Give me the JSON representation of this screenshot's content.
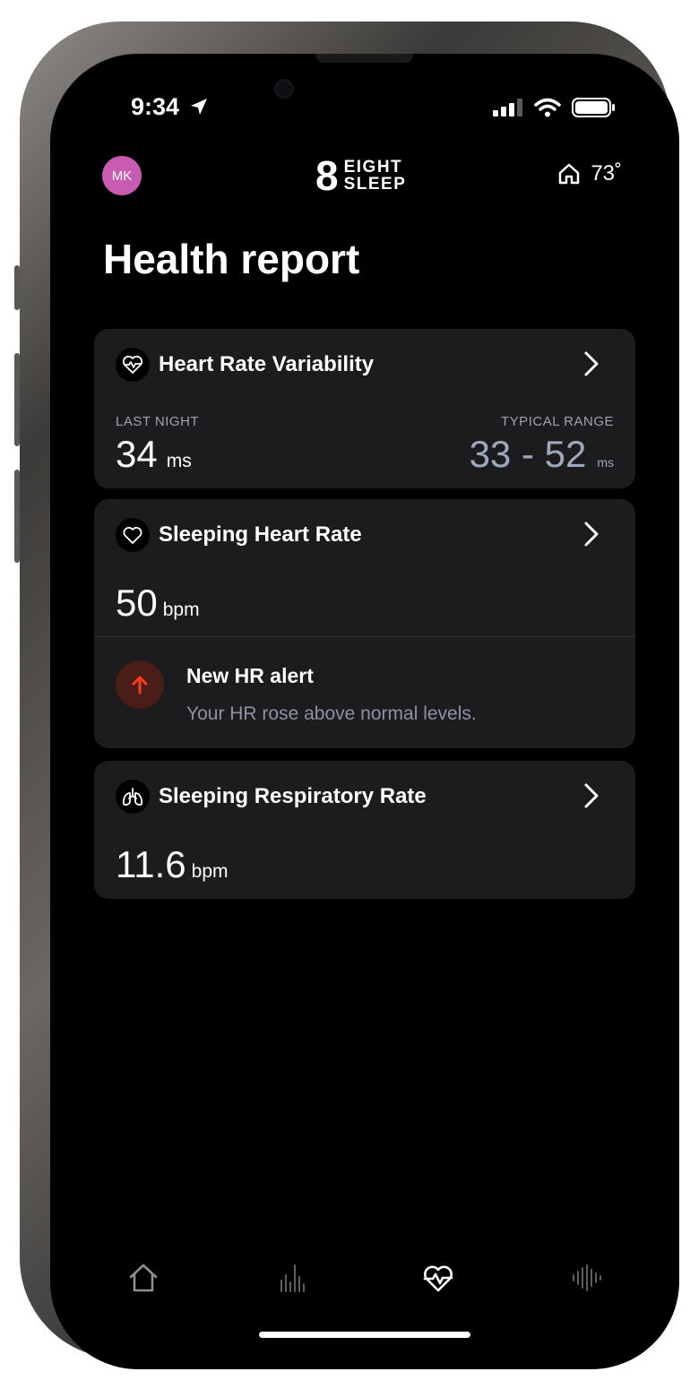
{
  "status_bar": {
    "time": "9:34"
  },
  "header": {
    "avatar_initials": "MK",
    "logo_mark": "8",
    "logo_line1": "EIGHT",
    "logo_line2": "SLEEP",
    "home_temperature": "73˚"
  },
  "page_title": "Health report",
  "cards": {
    "hrv": {
      "title": "Heart Rate Variability",
      "icon": "heart-pulse-icon",
      "last_night_label": "LAST NIGHT",
      "last_night_value": "34",
      "last_night_unit": "ms",
      "typical_range_label": "TYPICAL RANGE",
      "typical_range_value": "33 - 52",
      "typical_range_unit": "ms"
    },
    "heart_rate": {
      "title": "Sleeping Heart Rate",
      "icon": "heart-icon",
      "value": "50",
      "unit": "bpm",
      "alert_title": "New HR alert",
      "alert_description": "Your HR rose above normal levels."
    },
    "respiratory": {
      "title": "Sleeping Respiratory Rate",
      "icon": "lungs-icon",
      "value": "11.6",
      "unit": "bpm"
    }
  },
  "tab_bar": {
    "tabs": [
      "home-icon",
      "bar-chart-icon",
      "heart-pulse-icon",
      "sound-wave-icon"
    ],
    "active_tab": "heart-pulse-icon"
  },
  "colors": {
    "background": "#000000",
    "card": "#1c1c1e",
    "avatar": "#c95bb2",
    "alert_badge": "#4a1d17",
    "alert_arrow": "#ff3b1f",
    "muted_text": "#9ea3b3"
  }
}
